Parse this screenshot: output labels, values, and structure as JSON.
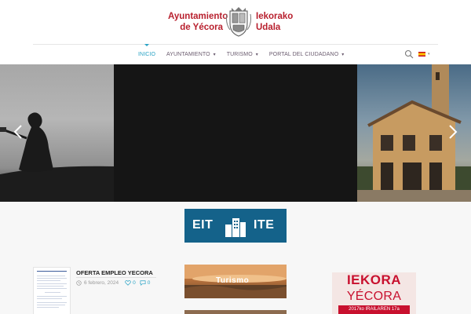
{
  "logo": {
    "left_line1": "Ayuntamiento",
    "left_line2": "de Yécora",
    "right_line1": "Iekorako",
    "right_line2": "Udala",
    "brand_color": "#b8202e",
    "crest_icon": "coat-of-arms-icon"
  },
  "nav": {
    "items": [
      {
        "label": "INICIO",
        "active": true,
        "dropdown": false
      },
      {
        "label": "AYUNTAMIENTO",
        "active": false,
        "dropdown": true
      },
      {
        "label": "TURISMO",
        "active": false,
        "dropdown": true
      },
      {
        "label": "PORTAL DEL CIUDADANO",
        "active": false,
        "dropdown": true
      }
    ],
    "active_color": "#2aa3c5",
    "search_icon": "search-icon",
    "language_icon": "spain-flag-icon"
  },
  "slider": {
    "prev_icon": "chevron-left-icon",
    "next_icon": "chevron-right-icon"
  },
  "banners": {
    "eit": {
      "left": "EIT",
      "right": "ITE"
    },
    "turismo": {
      "label": "Turismo"
    },
    "iekora": {
      "line1": "IEKORA",
      "line2": "YÉCORA",
      "line3": "2017ko IRAILAREN 17a"
    }
  },
  "news": {
    "title": "OFERTA EMPLEO YECORA",
    "date": "6 febrero, 2024",
    "likes": "0",
    "comments": "0",
    "calendar_icon": "clock-icon",
    "like_icon": "heart-icon",
    "comment_icon": "comment-icon"
  }
}
